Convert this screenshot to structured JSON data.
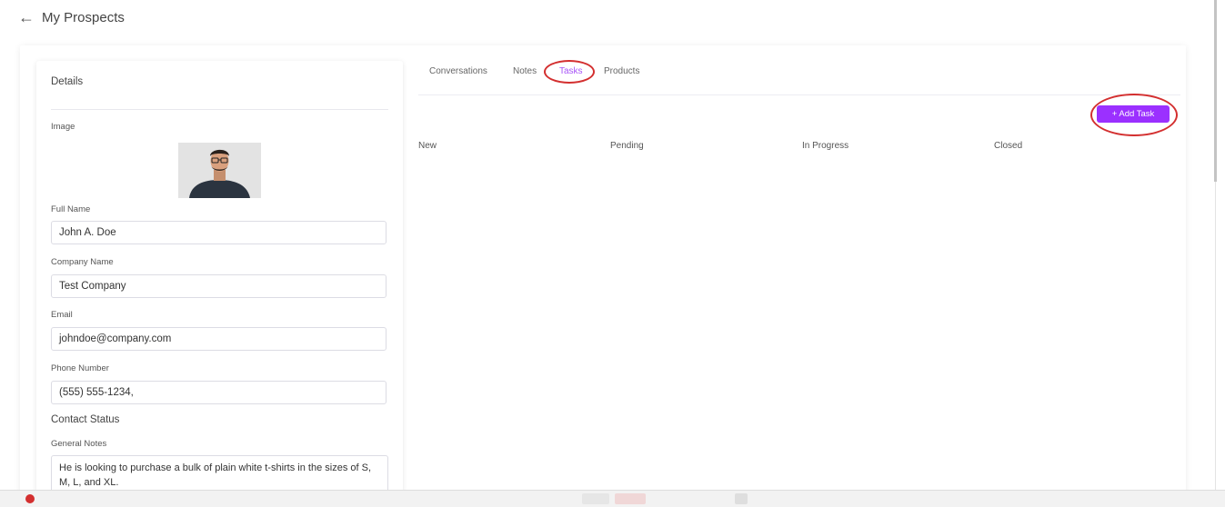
{
  "header": {
    "back_icon": "arrow-left-icon",
    "title": "My Prospects"
  },
  "details": {
    "title": "Details",
    "image_label": "Image",
    "full_name_label": "Full Name",
    "full_name_value": "John A. Doe",
    "company_label": "Company Name",
    "company_value": "Test Company",
    "email_label": "Email",
    "email_value": "johndoe@company.com",
    "phone_label": "Phone Number",
    "phone_value": "(555) 555-1234,",
    "contact_status_label": "Contact Status",
    "notes_label": "General Notes",
    "notes_value": "He is looking to purchase a bulk of plain white t-shirts in the sizes of S, M, L, and XL."
  },
  "tabs": [
    {
      "label": "Conversations",
      "active": false
    },
    {
      "label": "Notes",
      "active": false
    },
    {
      "label": "Tasks",
      "active": true
    },
    {
      "label": "Products",
      "active": false
    }
  ],
  "tasks": {
    "add_button_label": "+ Add Task",
    "columns": [
      "New",
      "Pending",
      "In Progress",
      "Closed"
    ]
  },
  "colors": {
    "accent": "#9b30ff",
    "active_tab": "#a855f7",
    "annotation": "#d32f2f"
  }
}
